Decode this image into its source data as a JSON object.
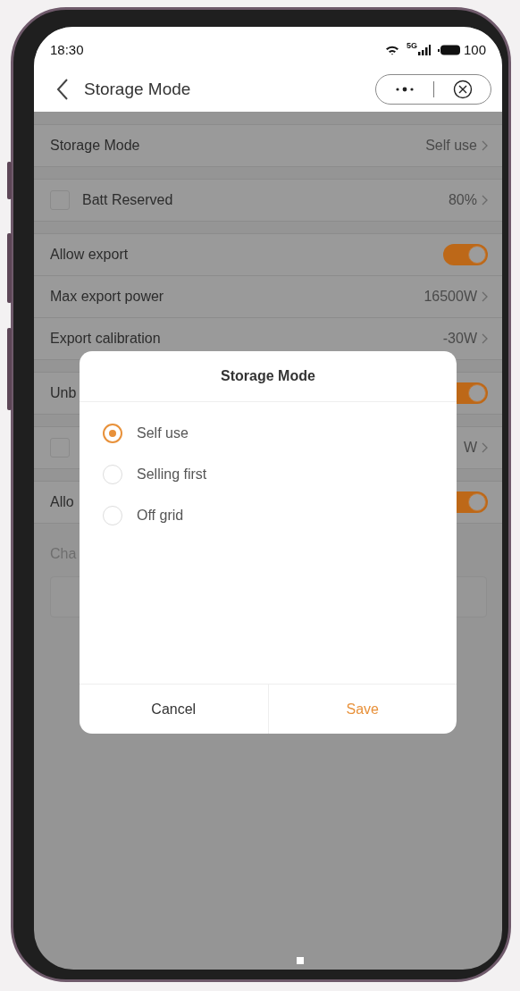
{
  "status_bar": {
    "time": "18:30",
    "network": "5G",
    "battery": "100"
  },
  "header": {
    "title": "Storage Mode"
  },
  "groups": [
    [
      {
        "kind": "select",
        "label": "Storage Mode",
        "value": "Self use"
      }
    ],
    [
      {
        "kind": "check_select",
        "checked": false,
        "label": "Batt Reserved",
        "value": "80%"
      }
    ],
    [
      {
        "kind": "toggle",
        "label": "Allow export",
        "on": true
      },
      {
        "kind": "select",
        "label": "Max export power",
        "value": "16500W"
      },
      {
        "kind": "select",
        "label": "Export calibration",
        "value": "-30W"
      }
    ],
    [
      {
        "kind": "toggle",
        "label": "Unb",
        "on": true
      }
    ],
    [
      {
        "kind": "check_select",
        "checked": false,
        "value": "W"
      }
    ],
    [
      {
        "kind": "toggle",
        "label": "Allo",
        "on": true
      }
    ]
  ],
  "section_label": "Cha",
  "dialog": {
    "title": "Storage Mode",
    "options": [
      {
        "label": "Self use",
        "selected": true
      },
      {
        "label": "Selling first",
        "selected": false
      },
      {
        "label": "Off grid",
        "selected": false
      }
    ],
    "buttons": [
      {
        "label": "Cancel",
        "kind": "cancel"
      },
      {
        "label": "Save",
        "kind": "primary"
      }
    ]
  }
}
